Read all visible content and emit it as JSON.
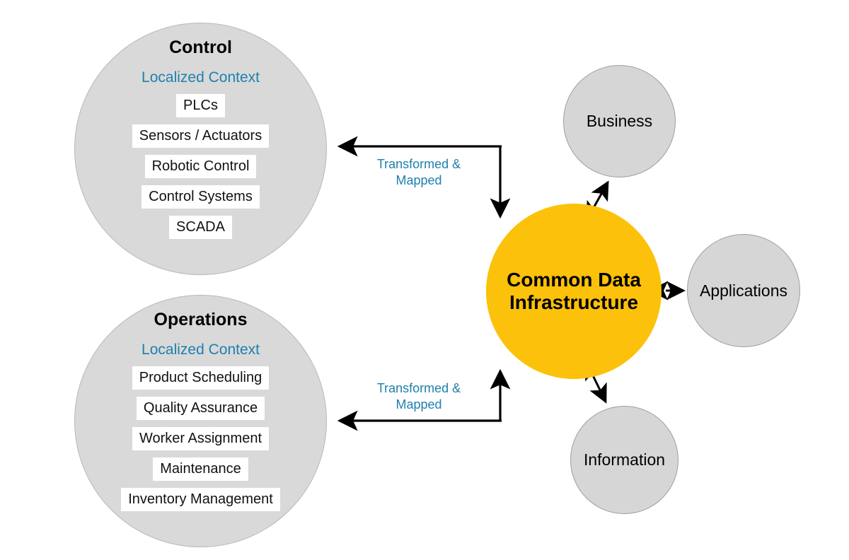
{
  "diagram": {
    "title": "Common Data Infrastructure",
    "background_color": "#ffffff",
    "colors": {
      "hub_fill": "#fcc10a",
      "domain_fill": "#d9d9d9",
      "satellite_fill": "#d6d6d6",
      "accent_text": "#1f80ad",
      "chip_fill": "#ffffff",
      "connector": "#000000"
    }
  },
  "hub": {
    "label": "Common Data\nInfrastructure"
  },
  "domains": [
    {
      "title": "Control",
      "subtitle": "Localized Context",
      "items": [
        "PLCs",
        "Sensors / Actuators",
        "Robotic Control",
        "Control Systems",
        "SCADA"
      ]
    },
    {
      "title": "Operations",
      "subtitle": "Localized Context",
      "items": [
        "Product Scheduling",
        "Quality Assurance",
        "Worker Assignment",
        "Maintenance",
        "Inventory Management"
      ]
    }
  ],
  "satellites": [
    {
      "label": "Business"
    },
    {
      "label": "Applications"
    },
    {
      "label": "Information"
    }
  ],
  "edges": [
    {
      "caption": "Transformed &\nMapped"
    },
    {
      "caption": "Transformed &\nMapped"
    }
  ]
}
